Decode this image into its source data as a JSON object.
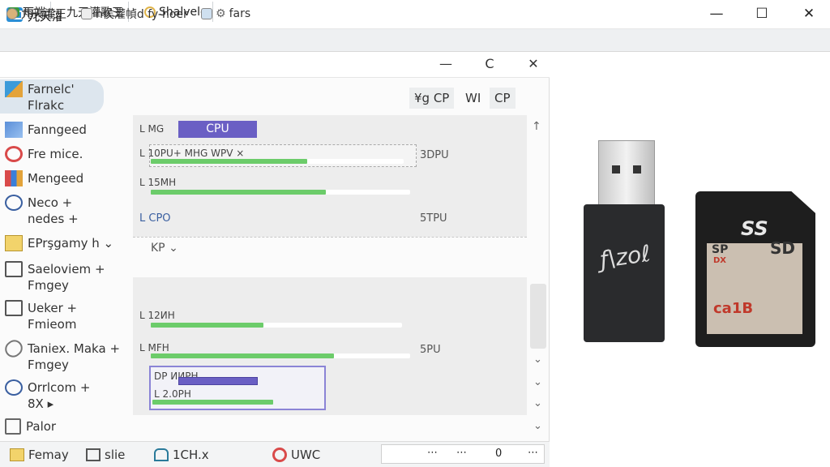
{
  "window": {
    "title": "九天灌歌王",
    "min": "—",
    "max": "☐",
    "close": "✕"
  },
  "tabs": [
    {
      "label": "雨端"
    },
    {
      "label": "九天灌歌王"
    },
    {
      "label": "Shalvele"
    }
  ],
  "inner_tabs": [
    {
      "label": "九天灌王"
    },
    {
      "label": "h侯灌幀d fy-hoer"
    },
    {
      "label": "fars"
    }
  ],
  "inner_controls": {
    "min": "—",
    "restore": "C",
    "close": "✕"
  },
  "sidebar": {
    "items": [
      {
        "label": "Farnelc'\nFlrakc",
        "icon": "puzzle-icon"
      },
      {
        "label": "Fanngeed",
        "icon": "pen-icon"
      },
      {
        "label": "Fre mice.",
        "icon": "gear-icon"
      },
      {
        "label": "Mengeed",
        "icon": "grid-icon"
      },
      {
        "label": "Neco + \nnedes +",
        "icon": "chat-icon"
      },
      {
        "label": "EPrşgamy h ⌄",
        "icon": "folder-icon"
      },
      {
        "label": "Saeloviem + \nFmgey",
        "icon": "note-icon"
      },
      {
        "label": "Ueker + \nFmieom",
        "icon": "edit-icon"
      },
      {
        "label": "Taniex. Maka + \nFmgey",
        "icon": "clip-icon"
      },
      {
        "label": "Orrlcom + \n8X ▸",
        "icon": "chat2-icon"
      },
      {
        "label": "Palor",
        "icon": "tools-icon"
      }
    ]
  },
  "header_buttons": [
    {
      "label": "¥g CP"
    },
    {
      "label": "WI"
    },
    {
      "label": "CP"
    }
  ],
  "group1": {
    "cpu_button": "CPU",
    "rows": [
      {
        "label": "L MG",
        "value": ""
      },
      {
        "label": "L 10PU+   MHG    WPV ×",
        "value": "3DPU",
        "fill": 0.62
      },
      {
        "label": "L 15MH",
        "value": "",
        "fill": 0.45
      },
      {
        "label": "L CPO",
        "value": "5TPU"
      }
    ],
    "dropdown": "KP ⌄"
  },
  "group2": {
    "rows": [
      {
        "label": "L 12ИH",
        "value": "",
        "fill": 0.29
      },
      {
        "label": "L MFH",
        "value": "5PU",
        "fill": 0.47
      },
      {
        "label": "DP  ИИPH",
        "value": "",
        "fill": 0.0
      },
      {
        "label": "L 2.0PH",
        "value": "",
        "fill": 0.31
      }
    ]
  },
  "statusbar": {
    "items": [
      {
        "label": "Femay"
      },
      {
        "label": "slie"
      },
      {
        "label": "1CH.x"
      },
      {
        "label": "UWC"
      }
    ],
    "box": {
      "a": "⋯",
      "b": "⋯",
      "c": "0",
      "d": "⋯"
    }
  },
  "product": {
    "usb_text": "ƒ\\zoℓ",
    "sd_top": "SS",
    "sd_sd": "SD",
    "sd_small": "SP",
    "sd_capacity": "ca1B",
    "sd_brand": "DX"
  }
}
